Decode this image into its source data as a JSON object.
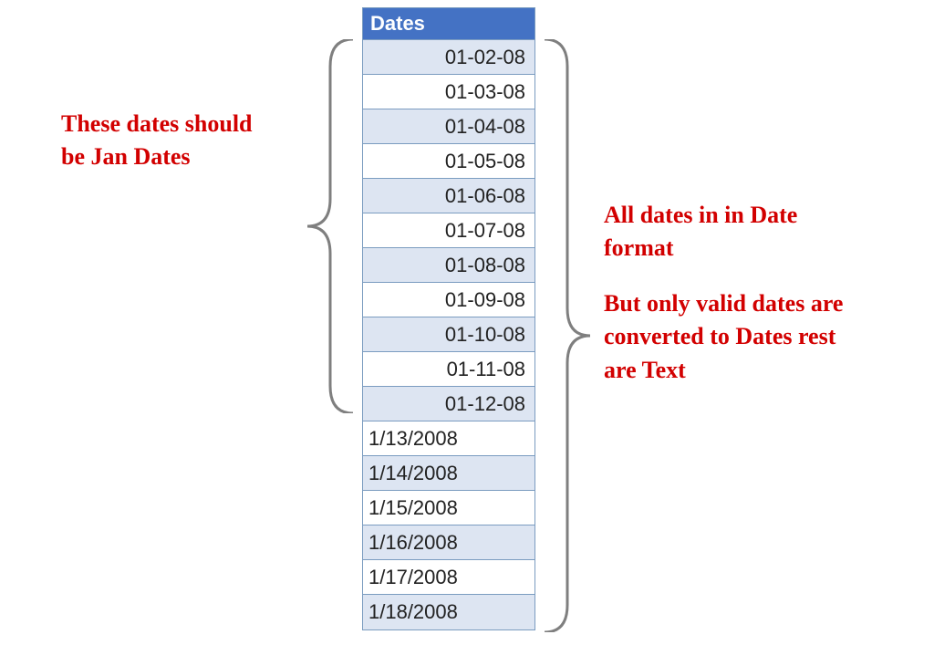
{
  "header": "Dates",
  "rows": [
    {
      "value": "01-02-08",
      "align": "right",
      "bandA": true
    },
    {
      "value": "01-03-08",
      "align": "right",
      "bandA": false
    },
    {
      "value": "01-04-08",
      "align": "right",
      "bandA": true
    },
    {
      "value": "01-05-08",
      "align": "right",
      "bandA": false
    },
    {
      "value": "01-06-08",
      "align": "right",
      "bandA": true
    },
    {
      "value": "01-07-08",
      "align": "right",
      "bandA": false
    },
    {
      "value": "01-08-08",
      "align": "right",
      "bandA": true
    },
    {
      "value": "01-09-08",
      "align": "right",
      "bandA": false
    },
    {
      "value": "01-10-08",
      "align": "right",
      "bandA": true
    },
    {
      "value": "01-11-08",
      "align": "right",
      "bandA": false
    },
    {
      "value": "01-12-08",
      "align": "right",
      "bandA": true
    },
    {
      "value": "1/13/2008",
      "align": "left",
      "bandA": false
    },
    {
      "value": "1/14/2008",
      "align": "left",
      "bandA": true
    },
    {
      "value": "1/15/2008",
      "align": "left",
      "bandA": false
    },
    {
      "value": "1/16/2008",
      "align": "left",
      "bandA": true
    },
    {
      "value": "1/17/2008",
      "align": "left",
      "bandA": false
    },
    {
      "value": "1/18/2008",
      "align": "left",
      "bandA": true
    }
  ],
  "annotations": {
    "left_line1": "These dates should",
    "left_line2": "be Jan Dates",
    "right_line1": "All dates in in Date",
    "right_line2": "format",
    "right_line3": "But only valid dates are",
    "right_line4": "converted to Dates rest",
    "right_line5": "are Text"
  }
}
